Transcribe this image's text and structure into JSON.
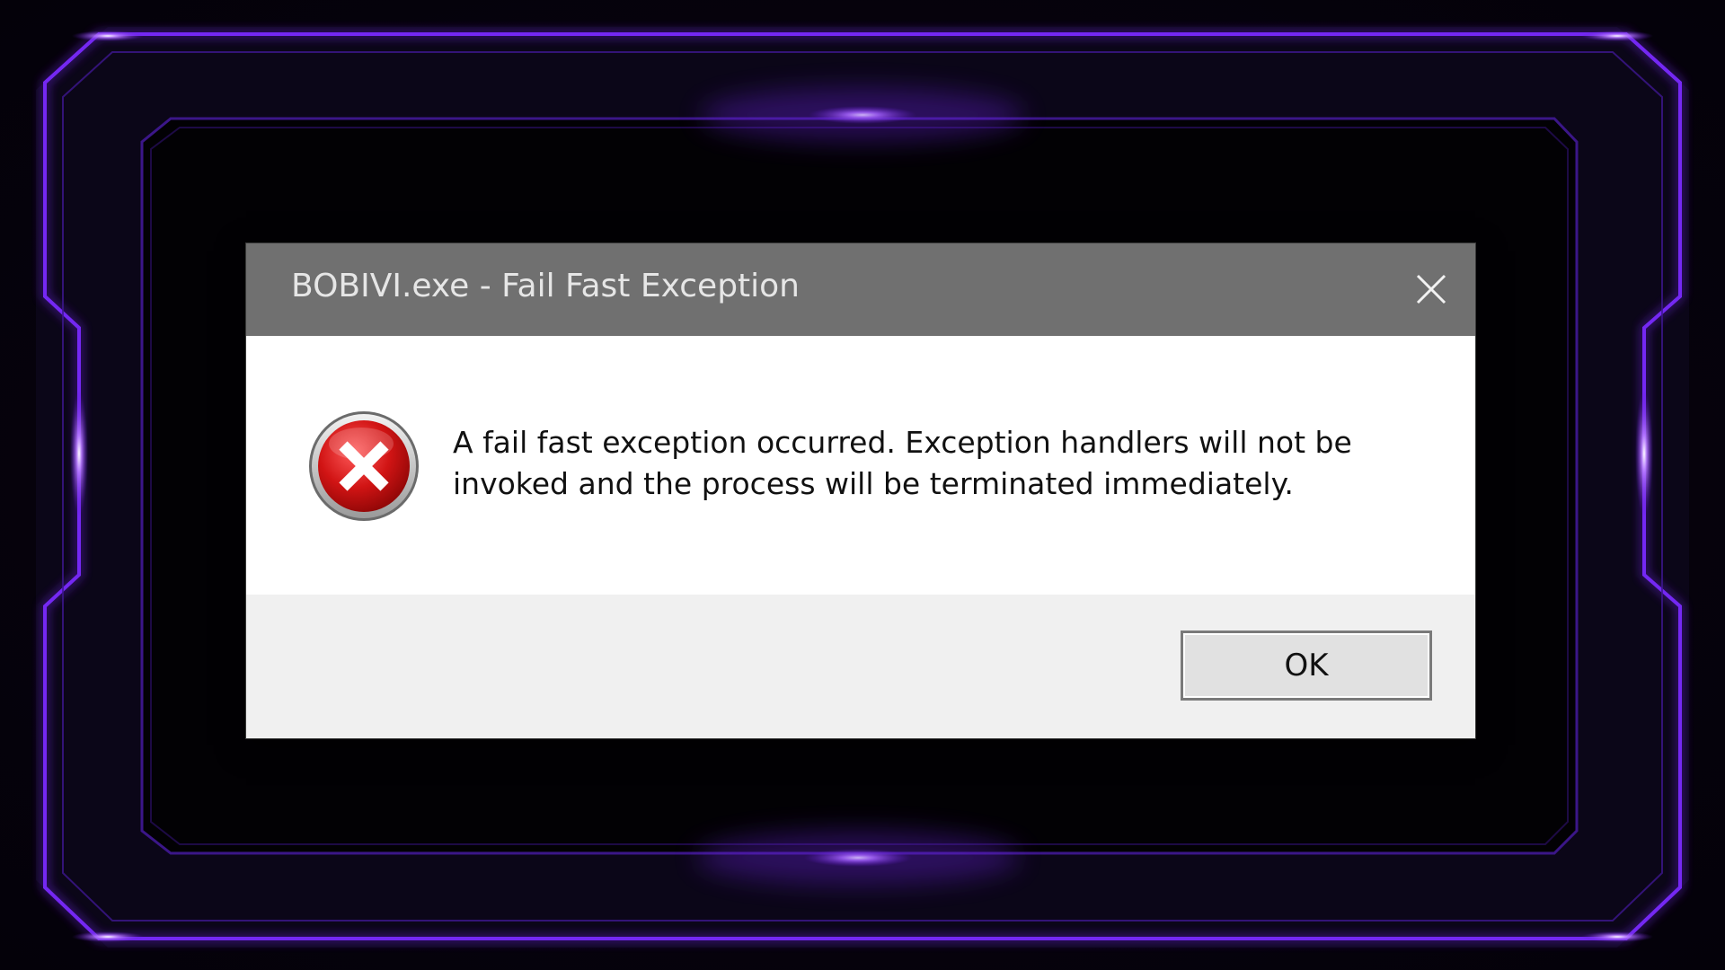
{
  "dialog": {
    "title": "BOBIVI.exe - Fail Fast Exception",
    "message": "A fail fast exception occurred. Exception handlers will not be invoked and the process will be terminated immediately.",
    "ok_label": "OK",
    "icon": "error-icon",
    "close_icon": "close-icon"
  },
  "theme": {
    "titlebar_color": "#707070",
    "frame_glow_color": "#8a3cff"
  }
}
